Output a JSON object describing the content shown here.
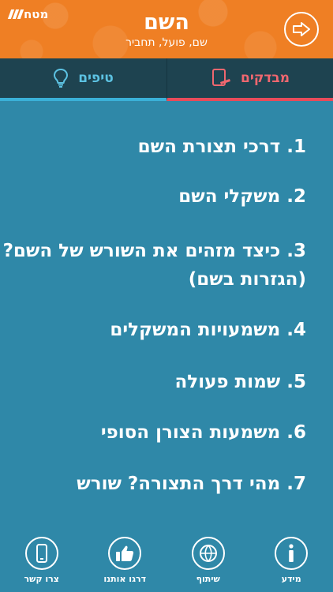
{
  "header": {
    "brand": "מטח",
    "title": "השם",
    "subtitle": "שם, פועל, תחביר"
  },
  "tabs": [
    {
      "label": "מבדקים",
      "icon": "quiz-icon",
      "color": "#e84b5a"
    },
    {
      "label": "טיפים",
      "icon": "lightbulb-icon",
      "color": "#3ab1d8"
    }
  ],
  "items": [
    {
      "label": "1. דרכי תצורת השם"
    },
    {
      "label": "2. משקלי השם"
    },
    {
      "label": "3. כיצד מזהים את השורש של השם? (הגזרות בשם)"
    },
    {
      "label": "4. משמעויות המשקלים"
    },
    {
      "label": "5. שמות פעולה"
    },
    {
      "label": "6. משמעות הצורן הסופי"
    },
    {
      "label": "7. מהי דרך התצורה? שורש"
    }
  ],
  "footer": [
    {
      "label": "מידע",
      "icon": "info-icon"
    },
    {
      "label": "שיתוף",
      "icon": "globe-share-icon"
    },
    {
      "label": "דרגו אותנו",
      "icon": "thumbs-up-icon"
    },
    {
      "label": "צרו קשר",
      "icon": "phone-icon"
    }
  ],
  "colors": {
    "header": "#ef7f24",
    "background": "#2f88a8",
    "tabs_bar": "#1e4350"
  }
}
